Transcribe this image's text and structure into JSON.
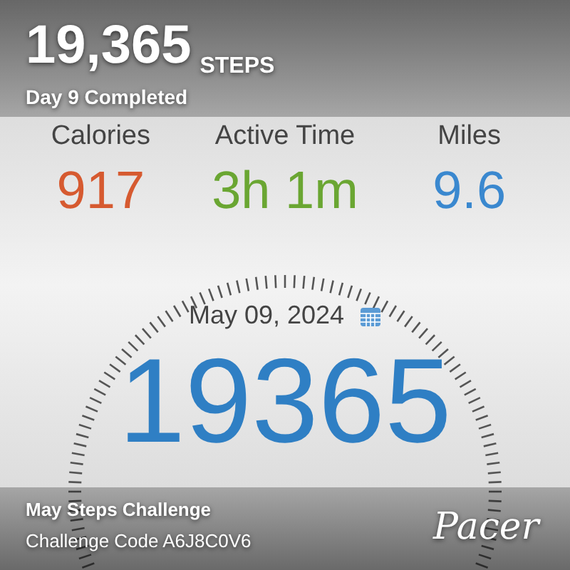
{
  "stats": [
    {
      "label": "Calories",
      "value": "917",
      "color": "#d65a30"
    },
    {
      "label": "Active Time",
      "value": "3h 1m",
      "color": "#6aa632"
    },
    {
      "label": "Miles",
      "value": "9.6",
      "color": "#3a88cf"
    }
  ],
  "date": "May 09, 2024",
  "step_count": "19365",
  "share_overlay": {
    "steps": "19,365",
    "steps_unit": "STEPS",
    "day_status": "Day 9 Completed",
    "challenge_name": "May Steps Challenge",
    "challenge_code": "Challenge Code A6J8C0V6",
    "brand": "Pacer"
  }
}
